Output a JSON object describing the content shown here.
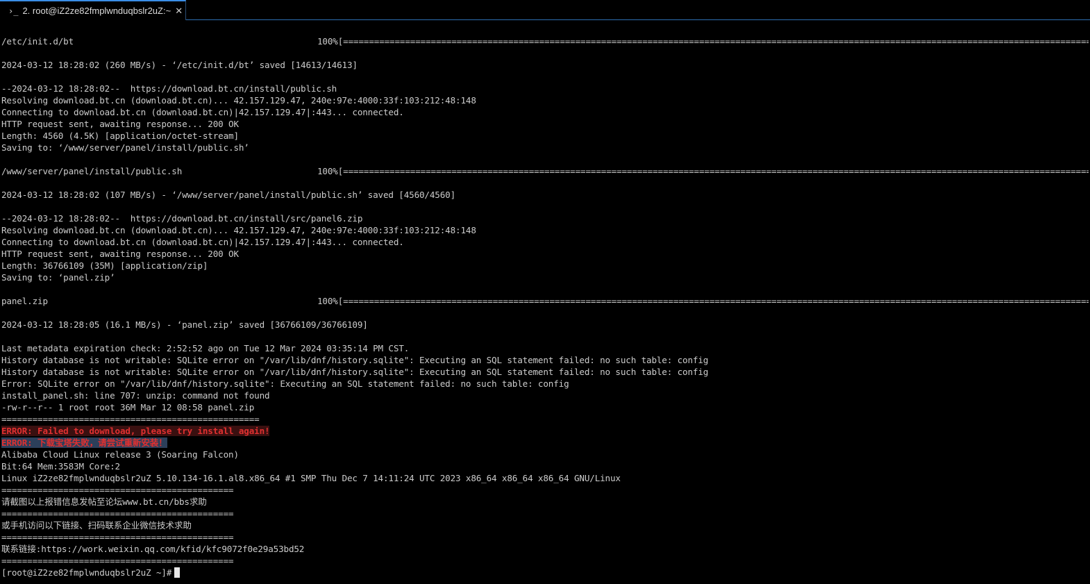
{
  "tab": {
    "title": "2. root@iZ2ze82fmplwnduqbslr2uZ:~",
    "prompt_icon": "›_",
    "close_icon": "✕"
  },
  "colors": {
    "background": "#000000",
    "text": "#cccccc",
    "error": "#e03030",
    "tab_accent": "#3a8ee6"
  },
  "terminal": {
    "lines": [
      {
        "type": "text",
        "text": ""
      },
      {
        "type": "progress",
        "label": "/etc/init.d/bt",
        "percent": "100%",
        "bar": "[========================================================================================================================================================================================>]"
      },
      {
        "type": "text",
        "text": ""
      },
      {
        "type": "text",
        "text": "2024-03-12 18:28:02 (260 MB/s) - ‘/etc/init.d/bt’ saved [14613/14613]"
      },
      {
        "type": "text",
        "text": ""
      },
      {
        "type": "text",
        "text": "--2024-03-12 18:28:02--  https://download.bt.cn/install/public.sh"
      },
      {
        "type": "text",
        "text": "Resolving download.bt.cn (download.bt.cn)... 42.157.129.47, 240e:97e:4000:33f:103:212:48:148"
      },
      {
        "type": "text",
        "text": "Connecting to download.bt.cn (download.bt.cn)|42.157.129.47|:443... connected."
      },
      {
        "type": "text",
        "text": "HTTP request sent, awaiting response... 200 OK"
      },
      {
        "type": "text",
        "text": "Length: 4560 (4.5K) [application/octet-stream]"
      },
      {
        "type": "text",
        "text": "Saving to: ‘/www/server/panel/install/public.sh’"
      },
      {
        "type": "text",
        "text": ""
      },
      {
        "type": "progress",
        "label": "/www/server/panel/install/public.sh",
        "percent": "100%",
        "bar": "[========================================================================================================================================================================================>]"
      },
      {
        "type": "text",
        "text": ""
      },
      {
        "type": "text",
        "text": "2024-03-12 18:28:02 (107 MB/s) - ‘/www/server/panel/install/public.sh’ saved [4560/4560]"
      },
      {
        "type": "text",
        "text": ""
      },
      {
        "type": "text",
        "text": "--2024-03-12 18:28:02--  https://download.bt.cn/install/src/panel6.zip"
      },
      {
        "type": "text",
        "text": "Resolving download.bt.cn (download.bt.cn)... 42.157.129.47, 240e:97e:4000:33f:103:212:48:148"
      },
      {
        "type": "text",
        "text": "Connecting to download.bt.cn (download.bt.cn)|42.157.129.47|:443... connected."
      },
      {
        "type": "text",
        "text": "HTTP request sent, awaiting response... 200 OK"
      },
      {
        "type": "text",
        "text": "Length: 36766109 (35M) [application/zip]"
      },
      {
        "type": "text",
        "text": "Saving to: ‘panel.zip’"
      },
      {
        "type": "text",
        "text": ""
      },
      {
        "type": "progress",
        "label": "panel.zip",
        "percent": "100%",
        "bar": "[========================================================================================================================================================================================>]"
      },
      {
        "type": "text",
        "text": ""
      },
      {
        "type": "text",
        "text": "2024-03-12 18:28:05 (16.1 MB/s) - ‘panel.zip’ saved [36766109/36766109]"
      },
      {
        "type": "text",
        "text": ""
      },
      {
        "type": "text",
        "text": "Last metadata expiration check: 2:52:52 ago on Tue 12 Mar 2024 03:35:14 PM CST."
      },
      {
        "type": "text",
        "text": "History database is not writable: SQLite error on \"/var/lib/dnf/history.sqlite\": Executing an SQL statement failed: no such table: config"
      },
      {
        "type": "text",
        "text": "History database is not writable: SQLite error on \"/var/lib/dnf/history.sqlite\": Executing an SQL statement failed: no such table: config"
      },
      {
        "type": "text",
        "text": "Error: SQLite error on \"/var/lib/dnf/history.sqlite\": Executing an SQL statement failed: no such table: config"
      },
      {
        "type": "text",
        "text": "install_panel.sh: line 707: unzip: command not found"
      },
      {
        "type": "text",
        "text": "-rw-r--r-- 1 root root 36M Mar 12 08:58 panel.zip"
      },
      {
        "type": "text",
        "text": "=================================================="
      },
      {
        "type": "error_red",
        "text": "ERROR: Failed to download, please try install again!"
      },
      {
        "type": "error_blue",
        "text": "ERROR: 下载宝塔失败，请尝试重新安装！"
      },
      {
        "type": "text",
        "text": "Alibaba Cloud Linux release 3 (Soaring Falcon)"
      },
      {
        "type": "text",
        "text": "Bit:64 Mem:3583M Core:2"
      },
      {
        "type": "text",
        "text": "Linux iZ2ze82fmplwnduqbslr2uZ 5.10.134-16.1.al8.x86_64 #1 SMP Thu Dec 7 14:11:24 UTC 2023 x86_64 x86_64 x86_64 GNU/Linux"
      },
      {
        "type": "text",
        "text": "============================================="
      },
      {
        "type": "text",
        "text": "请截图以上报错信息发帖至论坛www.bt.cn/bbs求助"
      },
      {
        "type": "text",
        "text": "============================================="
      },
      {
        "type": "text",
        "text": "或手机访问以下链接、扫码联系企业微信技术求助"
      },
      {
        "type": "text",
        "text": "============================================="
      },
      {
        "type": "text",
        "text": "联系链接:https://work.weixin.qq.com/kfid/kfc9072f0e29a53bd52"
      },
      {
        "type": "text",
        "text": "============================================="
      }
    ],
    "prompt": "[root@iZ2ze82fmplwnduqbslr2uZ ~]#"
  }
}
